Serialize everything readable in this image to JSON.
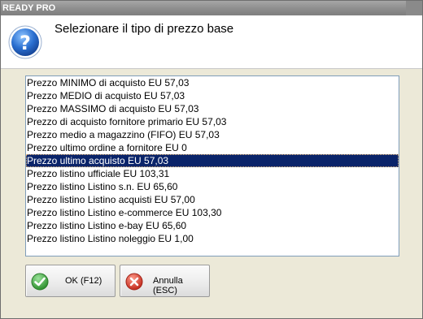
{
  "window": {
    "title": "READY PRO"
  },
  "header": {
    "icon": "question-icon",
    "title": "Selezionare il tipo di prezzo base"
  },
  "list": {
    "selected_index": 6,
    "items": [
      "Prezzo MINIMO di acquisto EU 57,03",
      "Prezzo MEDIO di acquisto EU 57,03",
      "Prezzo MASSIMO di acquisto EU 57,03",
      "Prezzo di acquisto fornitore primario EU 57,03",
      "Prezzo medio a magazzino (FIFO) EU 57,03",
      "Prezzo ultimo ordine a fornitore EU 0",
      "Prezzo ultimo acquisto EU 57,03",
      "Prezzo listino ufficiale EU 103,31",
      "Prezzo listino Listino s.n. EU 65,60",
      "Prezzo listino Listino acquisti EU 57,00",
      "Prezzo listino Listino e-commerce EU 103,30",
      "Prezzo listino Listino e-bay EU 65,60",
      "Prezzo listino Listino noleggio EU 1,00"
    ]
  },
  "buttons": {
    "ok_label": "OK (F12)",
    "ok_icon": "check-icon",
    "cancel_label": "Annulla (ESC)",
    "cancel_icon": "cancel-icon"
  },
  "colors": {
    "selection": "#0a246a",
    "ok_green": "#3aa63a",
    "cancel_red": "#d23a2a",
    "icon_blue": "#2a6fd0"
  }
}
